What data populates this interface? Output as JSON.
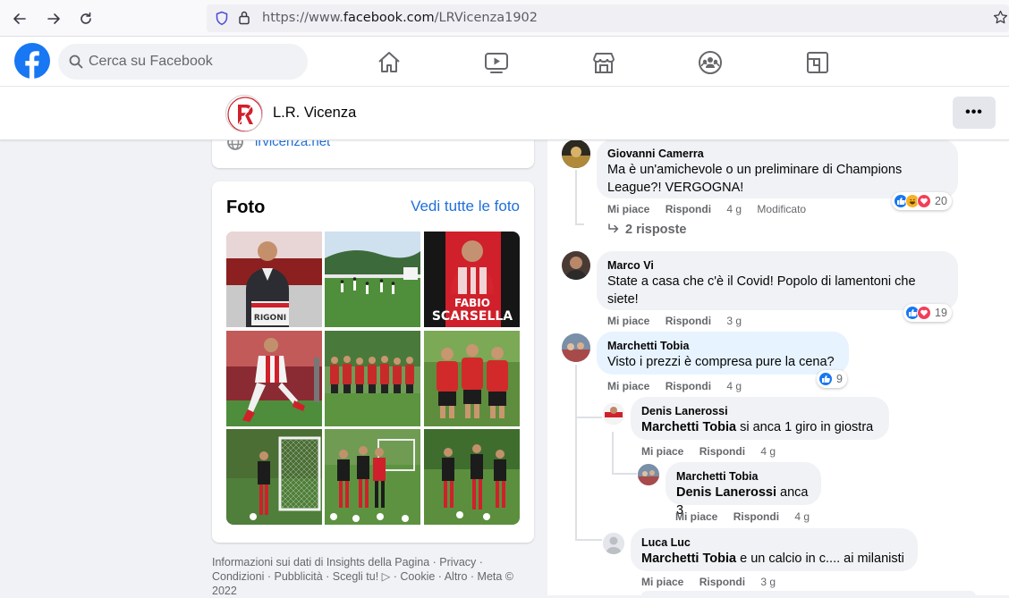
{
  "browser": {
    "url_prefix": "https://www.",
    "url_domain": "facebook.com",
    "url_path": "/LRVicenza1902"
  },
  "header": {
    "search_placeholder": "Cerca su Facebook"
  },
  "page": {
    "name": "L.R. Vicenza",
    "more_label": "•••"
  },
  "intro": {
    "website": "lrvicenza.net"
  },
  "photos": {
    "title": "Foto",
    "see_all": "Vedi tutte le foto",
    "poster_text_1": "FABIO",
    "poster_text_2": "SCARSELLA",
    "shirt_text": "RIGONI"
  },
  "footer": {
    "text": "Informazioni sui dati di Insights della Pagina · Privacy · Condizioni · Pubblicità · Scegli tu! ▷ · Cookie · Altro · Meta © 2022"
  },
  "comments": [
    {
      "author": "Giovanni Camerra",
      "text": "Ma è un'amichevole o un preliminare di Champions League?! VERGOGNA!",
      "like": "Mi piace",
      "reply": "Rispondi",
      "time": "4 g",
      "edited": "Modificato",
      "reactions": "20",
      "replies_label": "2 risposte"
    },
    {
      "author": "Marco Vi",
      "text": "State a casa che c'è il Covid! Popolo di lamentoni che siete!",
      "like": "Mi piace",
      "reply": "Rispondi",
      "time": "3 g",
      "reactions": "19"
    },
    {
      "author": "Marchetti Tobia",
      "text": "Visto i prezzi è compresa pure la cena?",
      "like": "Mi piace",
      "reply": "Rispondi",
      "time": "4 g",
      "reactions": "9",
      "replies": [
        {
          "author": "Denis Lanerossi",
          "mention": "Marchetti Tobia",
          "text": " si anca 1 giro in giostra",
          "like": "Mi piace",
          "reply": "Rispondi",
          "time": "4 g"
        },
        {
          "author": "Marchetti Tobia",
          "mention": "Denis Lanerossi",
          "text": " anca 3",
          "like": "Mi piace",
          "reply": "Rispondi",
          "time": "4 g"
        },
        {
          "author": "Luca Luc",
          "mention": "Marchetti Tobia",
          "text": " e un calcio in c.... ai milanisti",
          "like": "Mi piace",
          "reply": "Rispondi",
          "time": "3 g"
        }
      ]
    }
  ],
  "colors": {
    "facebook_blue": "#1877f2",
    "link_blue": "#216fdb",
    "vicenza_red": "#d0202b"
  }
}
